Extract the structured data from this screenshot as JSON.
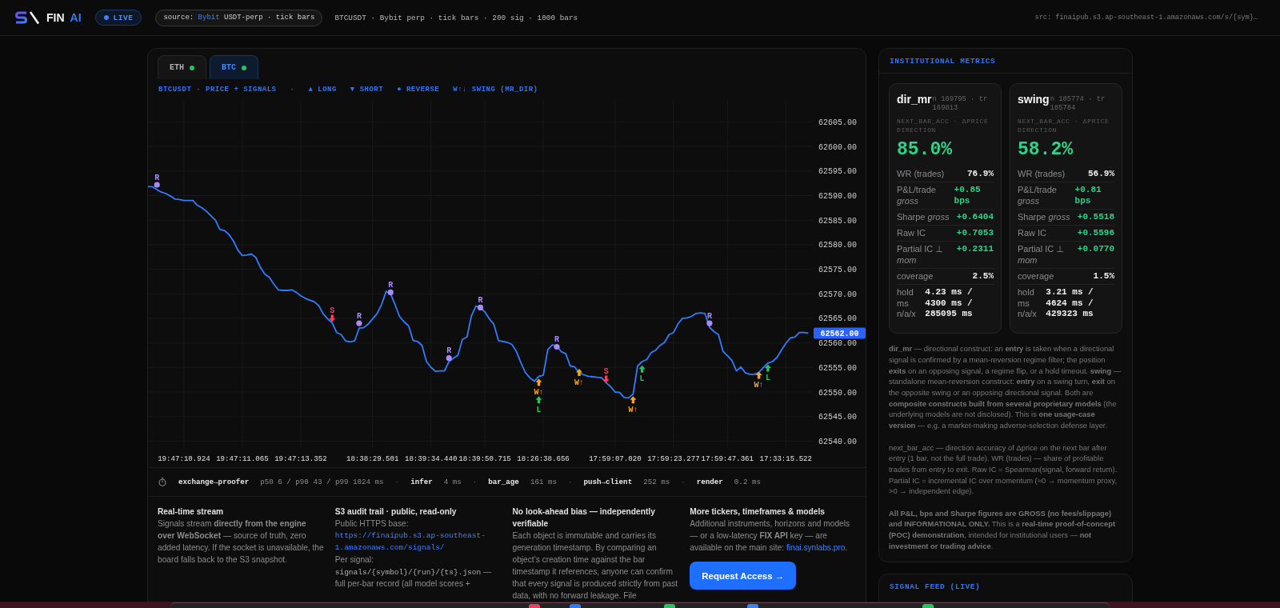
{
  "topbar": {
    "brand": {
      "name": "FIN",
      "accent": "AI"
    },
    "live_badge": "LIVE",
    "source": {
      "prefix": "source:",
      "exchange": "Bybit",
      "suffix": "USDT-perp · tick bars"
    },
    "summary": "BTCUSDT · Bybit perp · tick bars · 200 sig · 1000 bars",
    "src": "src: finaipub.s3.ap-southeast-1.amazonaws.com/s/{sym}…"
  },
  "chart_panel": {
    "tabs": [
      {
        "label": "ETH",
        "selected": false
      },
      {
        "label": "BTC",
        "selected": true
      }
    ],
    "legend_separator": "·",
    "chart_data": {
      "type": "line",
      "title": "BTCUSDT · PRICE + SIGNALS",
      "grid": true,
      "categories": [
        null,
        null,
        null,
        null,
        null,
        null,
        null,
        null,
        "19:47:10.924",
        null,
        null,
        null,
        null,
        null,
        null,
        null,
        null,
        null,
        null,
        null,
        null,
        "19:47:11.065",
        null,
        null,
        null,
        null,
        null,
        null,
        null,
        null,
        null,
        null,
        null,
        null,
        "19:47:13.352",
        null,
        null,
        null,
        null,
        null,
        null,
        null,
        null,
        null,
        null,
        null,
        null,
        null,
        null,
        null,
        "18:38:29.501",
        null,
        null,
        null,
        null,
        null,
        null,
        null,
        null,
        null,
        null,
        null,
        null,
        "18:39:34.440",
        null,
        null,
        null,
        null,
        null,
        null,
        null,
        null,
        null,
        null,
        null,
        "18:39:50.715",
        null,
        null,
        null,
        null,
        null,
        null,
        null,
        null,
        null,
        null,
        null,
        null,
        "18:26:38.656",
        null,
        null,
        null,
        null,
        null,
        null,
        null,
        null,
        null,
        null,
        null,
        null,
        null,
        null,
        null,
        "17:59:07.020",
        null,
        null,
        null,
        null,
        null,
        null,
        null,
        null,
        null,
        null,
        null,
        null,
        "17:59:23.277",
        null,
        null,
        null,
        null,
        null,
        null,
        null,
        null,
        null,
        null,
        null,
        "17:59:47.361",
        null,
        null,
        null,
        null,
        null,
        null,
        null,
        null,
        null,
        null,
        null,
        null,
        "17:33:15.522",
        null,
        null,
        null,
        null,
        null
      ],
      "series": [
        {
          "color": "#2f7dff",
          "values": [
            62591.8,
            62591.8,
            62591.2,
            62590.7,
            62590.4,
            62589.9,
            62589.3,
            62589.2,
            62589.0,
            62589.0,
            62589.0,
            62588.0,
            62587.5,
            62586.8,
            62585.9,
            62585.0,
            62583.1,
            62582.9,
            62582.1,
            62580.8,
            62578.9,
            62577.8,
            62577.9,
            62578.1,
            62577.4,
            62575.4,
            62574.0,
            62573.4,
            62572.0,
            62570.8,
            62570.7,
            62570.7,
            62570.8,
            62570.3,
            62569.6,
            62569.1,
            62568.7,
            62568.4,
            62567.6,
            62565.9,
            62564.9,
            62564.1,
            62562.1,
            62561.7,
            62560.4,
            62560.2,
            62560.4,
            62563.0,
            62563.1,
            62563.8,
            62564.9,
            62566.0,
            62567.8,
            62570.5,
            62570.0,
            62567.8,
            62565.4,
            62564.3,
            62563.5,
            62560.5,
            62560.3,
            62559.5,
            62556.2,
            62555.0,
            62554.2,
            62554.3,
            62554.3,
            62556.2,
            62556.9,
            62557.5,
            62560.7,
            62561.2,
            62565.5,
            62567.5,
            62567.2,
            62566.3,
            62564.9,
            62563.8,
            62560.5,
            62560.3,
            62560.1,
            62559.7,
            62558.3,
            62556.0,
            62554.0,
            62552.9,
            62552.2,
            62553.2,
            62553.4,
            62558.6,
            62559.6,
            62559.4,
            62558.2,
            62557.8,
            62555.3,
            62555.1,
            62553.9,
            62553.5,
            62553.2,
            62553.1,
            62553.0,
            62552.9,
            62551.9,
            62551.1,
            62550.0,
            62549.9,
            62548.9,
            62548.8,
            62549.6,
            62555.3,
            62556.2,
            62556.6,
            62558.0,
            62558.5,
            62559.5,
            62560.1,
            62561.7,
            62562.1,
            62563.9,
            62565.0,
            62565.1,
            62565.4,
            62566.0,
            62566.1,
            62566.0,
            62563.2,
            62562.3,
            62561.7,
            62558.3,
            62557.4,
            62556.4,
            62554.3,
            62555.1,
            62553.9,
            62553.6,
            62553.6,
            62554.0,
            62555.0,
            62555.9,
            62556.2,
            62557.0,
            62558.5,
            62559.9,
            62561.0,
            62561.2,
            62562.1,
            62562.1,
            62562.0
          ]
        },
        {
          "name": "▲ LONG",
          "type": "scatter",
          "color": "#22c55e",
          "values": [
            null,
            null,
            null,
            null,
            null,
            null,
            null,
            null,
            null,
            null,
            null,
            null,
            null,
            null,
            null,
            null,
            null,
            null,
            null,
            null,
            null,
            null,
            null,
            null,
            null,
            null,
            null,
            null,
            null,
            null,
            null,
            null,
            null,
            null,
            null,
            null,
            null,
            null,
            null,
            null,
            null,
            null,
            null,
            null,
            null,
            null,
            null,
            null,
            null,
            null,
            null,
            null,
            null,
            null,
            null,
            null,
            null,
            null,
            null,
            null,
            null,
            null,
            null,
            null,
            null,
            null,
            null,
            null,
            null,
            null,
            null,
            null,
            null,
            null,
            null,
            null,
            null,
            null,
            null,
            null,
            null,
            null,
            null,
            null,
            null,
            null,
            null,
            62548.4,
            null,
            null,
            null,
            null,
            null,
            null,
            null,
            null,
            null,
            null,
            null,
            null,
            null,
            null,
            null,
            null,
            null,
            null,
            null,
            null,
            null,
            null,
            62554.7,
            null,
            null,
            null,
            null,
            null,
            null,
            null,
            null,
            null,
            null,
            null,
            null,
            null,
            null,
            null,
            null,
            null,
            null,
            null,
            null,
            null,
            null,
            null,
            null,
            null,
            null,
            null,
            62554.9,
            null,
            null,
            null,
            null,
            null,
            null,
            null,
            null,
            null
          ]
        },
        {
          "name": "▼ SHORT",
          "type": "scatter",
          "color": "#f2405a",
          "values": [
            null,
            null,
            null,
            null,
            null,
            null,
            null,
            null,
            null,
            null,
            null,
            null,
            null,
            null,
            null,
            null,
            null,
            null,
            null,
            null,
            null,
            null,
            null,
            null,
            null,
            null,
            null,
            null,
            null,
            null,
            null,
            null,
            null,
            null,
            null,
            null,
            null,
            null,
            null,
            null,
            null,
            62565.0,
            null,
            null,
            null,
            null,
            null,
            null,
            null,
            null,
            null,
            null,
            null,
            null,
            null,
            null,
            null,
            null,
            null,
            null,
            null,
            null,
            null,
            null,
            null,
            null,
            null,
            null,
            null,
            null,
            null,
            null,
            null,
            null,
            null,
            null,
            null,
            null,
            null,
            null,
            null,
            null,
            null,
            null,
            null,
            null,
            null,
            null,
            null,
            null,
            null,
            null,
            null,
            null,
            null,
            null,
            null,
            null,
            null,
            null,
            null,
            null,
            62552.6,
            null,
            null,
            null,
            null,
            null,
            null,
            null,
            null,
            null,
            null,
            null,
            null,
            null,
            null,
            null,
            null,
            null,
            null,
            null,
            null,
            null,
            null,
            null,
            null,
            null,
            null,
            null,
            null,
            null,
            null,
            null,
            null,
            null,
            null,
            null,
            null,
            null,
            null,
            null,
            null,
            null,
            null,
            null,
            null,
            null
          ]
        },
        {
          "name": "● REVERSE",
          "type": "scatter",
          "color": "#a78bfa",
          "values": [
            null,
            null,
            62592.2,
            null,
            null,
            null,
            null,
            null,
            null,
            null,
            null,
            null,
            null,
            null,
            null,
            null,
            null,
            null,
            null,
            null,
            null,
            null,
            null,
            null,
            null,
            null,
            null,
            null,
            null,
            null,
            null,
            null,
            null,
            null,
            null,
            null,
            null,
            null,
            null,
            null,
            null,
            null,
            null,
            null,
            null,
            null,
            null,
            62564.0,
            null,
            null,
            null,
            null,
            null,
            null,
            62570.3,
            null,
            null,
            null,
            null,
            null,
            null,
            null,
            null,
            null,
            null,
            null,
            null,
            62556.9,
            null,
            null,
            null,
            null,
            null,
            null,
            62567.2,
            null,
            null,
            null,
            null,
            null,
            null,
            null,
            null,
            null,
            null,
            null,
            null,
            null,
            null,
            null,
            null,
            62559.2,
            null,
            null,
            null,
            null,
            null,
            null,
            null,
            null,
            null,
            null,
            null,
            null,
            null,
            null,
            null,
            null,
            null,
            null,
            null,
            null,
            null,
            null,
            null,
            null,
            null,
            null,
            null,
            null,
            null,
            null,
            null,
            null,
            null,
            62564.0,
            null,
            null,
            null,
            null,
            null,
            null,
            null,
            null,
            null,
            null,
            null,
            null,
            null,
            null,
            null,
            null,
            null,
            null,
            null,
            null,
            null,
            null
          ]
        },
        {
          "name": "W↑↓ SWING (MR_DIR)",
          "type": "scatter",
          "color": "#f5a524",
          "values": [
            null,
            null,
            null,
            null,
            null,
            null,
            null,
            null,
            null,
            null,
            null,
            null,
            null,
            null,
            null,
            null,
            null,
            null,
            null,
            null,
            null,
            null,
            null,
            null,
            null,
            null,
            null,
            null,
            null,
            null,
            null,
            null,
            null,
            null,
            null,
            null,
            null,
            null,
            null,
            null,
            null,
            null,
            null,
            null,
            null,
            null,
            null,
            null,
            null,
            null,
            null,
            null,
            null,
            null,
            null,
            null,
            null,
            null,
            null,
            null,
            null,
            null,
            null,
            null,
            null,
            null,
            null,
            null,
            null,
            null,
            null,
            null,
            null,
            null,
            null,
            null,
            null,
            null,
            null,
            null,
            null,
            null,
            null,
            null,
            null,
            null,
            null,
            62552.0,
            null,
            null,
            null,
            null,
            null,
            null,
            null,
            null,
            62554.0,
            null,
            null,
            null,
            null,
            null,
            null,
            null,
            null,
            null,
            null,
            null,
            62548.4,
            null,
            null,
            null,
            null,
            null,
            null,
            null,
            null,
            null,
            null,
            null,
            null,
            null,
            null,
            null,
            null,
            null,
            null,
            null,
            null,
            null,
            null,
            null,
            null,
            null,
            null,
            null,
            62553.4,
            null,
            null,
            null,
            null,
            null,
            null,
            null,
            null,
            null,
            null,
            null
          ]
        }
      ],
      "ylim": [
        62538.6,
        62609.3
      ],
      "yticks": [
        {
          "value": 62540,
          "label": "62540.00"
        },
        {
          "value": 62545,
          "label": "62545.00"
        },
        {
          "value": 62550,
          "label": "62550.00"
        },
        {
          "value": 62555,
          "label": "62555.00"
        },
        {
          "value": 62560,
          "label": "62560.00"
        },
        {
          "value": 62565,
          "label": "62565.00"
        },
        {
          "value": 62570,
          "label": "62570.00"
        },
        {
          "value": 62575,
          "label": "62575.00"
        },
        {
          "value": 62580,
          "label": "62580.00"
        },
        {
          "value": 62585,
          "label": "62585.00"
        },
        {
          "value": 62590,
          "label": "62590.00"
        },
        {
          "value": 62595,
          "label": "62595.00"
        },
        {
          "value": 62600,
          "label": "62600.00"
        },
        {
          "value": 62605,
          "label": "62605.00"
        }
      ],
      "annotations": [
        "L",
        "L",
        "L",
        "S",
        "S",
        "R",
        "R",
        "R",
        "R",
        "R",
        "R",
        "R",
        "W↑",
        "W↑",
        "W↑",
        "W↑",
        "62562.00"
      ]
    }
  },
  "latency": {
    "separator": "·",
    "items": [
      {
        "name": "exchange→proofer",
        "value": "p50 6 / p90 43 / p99 1024 ms"
      },
      {
        "name": "infer",
        "value": "4 ms"
      },
      {
        "name": "bar_age",
        "value": "161 ms"
      },
      {
        "name": "push→client",
        "value": "252 ms"
      },
      {
        "name": "render",
        "value": "0.2 ms"
      }
    ]
  },
  "info_columns": [
    {
      "kind": "text",
      "title": "Real-time stream",
      "body": "Signals stream **directly from the engine over WebSocket** — source of truth, zero added latency. If the socket is unavailable, the board falls back to the S3 snapshot."
    },
    {
      "kind": "audit",
      "title": "S3 audit trail · public, read-only",
      "body": "Public HTTPS base:",
      "link": "https://finaipub.s3.ap-southeast-1.amazonaws.com/signals/",
      "detail_label": "Per signal:",
      "path": "signals/{symbol}/{run}/{ts}.json",
      "path_note": "— full per-bar record (all model scores +"
    },
    {
      "kind": "text",
      "title": "No look-ahead bias — independently verifiable",
      "body": "Each object is immutable and carries its generation timestamp. By comparing an object’s creation time against the bar timestamp it references, anyone can confirm that every signal is produced strictly from past data, with no forward leakage. File"
    },
    {
      "kind": "cta",
      "title": "More tickers, timeframes & models",
      "body": "Additional instruments, horizons and models — or a low-latency **FIX API** key — are available on the main site:",
      "link": "finai.synlabs.pro",
      "link_suffix": ".",
      "button": "Request Access →"
    }
  ],
  "metrics": {
    "title": "INSTITUTIONAL METRICS",
    "models": [
      {
        "name": "dir_mr",
        "meta": "n 169795 · tr 169813",
        "caption": "NEXT_BAR_ACC · ΔPRICE DIRECTION",
        "headline": "85.0%",
        "rows": [
          {
            "label": "WR (trades)",
            "value": "76.9%",
            "color": "#f0f0f0"
          },
          {
            "label": "P&L/trade *gross*",
            "value": "+0.85 bps",
            "color": "#2ad48a"
          },
          {
            "label": "Sharpe *gross*",
            "value": "+0.6404",
            "color": "#2ad48a"
          },
          {
            "label": "Raw IC",
            "value": "+0.7053",
            "color": "#2ad48a"
          },
          {
            "label": "Partial IC ⊥ *mom*",
            "value": "+0.2311",
            "color": "#2ad48a"
          },
          {
            "label": "coverage",
            "value": "2.5%",
            "color": "#f0f0f0"
          },
          {
            "label": "hold ms n/a/x",
            "value": "4.23 ms / 4300 ms / 285095 ms",
            "color": "#f0f0f0"
          }
        ]
      },
      {
        "name": "swing",
        "meta": "n 185774 · tr 185784",
        "caption": "NEXT_BAR_ACC · ΔPRICE DIRECTION",
        "headline": "58.2%",
        "rows": [
          {
            "label": "WR (trades)",
            "value": "56.9%",
            "color": "#f0f0f0"
          },
          {
            "label": "P&L/trade *gross*",
            "value": "+0.81 bps",
            "color": "#2ad48a"
          },
          {
            "label": "Sharpe *gross*",
            "value": "+0.5518",
            "color": "#2ad48a"
          },
          {
            "label": "Raw IC",
            "value": "+0.5596",
            "color": "#2ad48a"
          },
          {
            "label": "Partial IC ⊥ *mom*",
            "value": "+0.0770",
            "color": "#2ad48a"
          },
          {
            "label": "coverage",
            "value": "1.5%",
            "color": "#f0f0f0"
          },
          {
            "label": "hold ms n/a/x",
            "value": "3.21 ms / 4624 ms / 429323 ms",
            "color": "#f0f0f0"
          }
        ]
      }
    ],
    "notes": [
      "**dir_mr** — directional construct: an **entry** is taken when a directional signal is confirmed by a mean-reversion regime filter; the position **exits** on an opposing signal, a regime flip, or a hold timeout. **swing** — standalone mean-reversion construct: **entry** on a swing turn, **exit** on the opposite swing or an opposing directional signal. Both are **composite constructs built from several proprietary models** (the underlying models are not disclosed). This is **one usage-case version** — e.g. a market-making adverse-selection defense layer.",
      "next_bar_acc — direction accuracy of Δprice on the next bar after entry (1 bar, not the full trade). WR (trades) — share of profitable trades from entry to exit. Raw IC = Spearman(signal, forward return). Partial IC = incremental IC over momentum (≈0 → momentum proxy, >0 → independent edge).",
      "**All P&L, bps and Sharpe figures are GROSS (no fees/slippage) and INFORMATIONAL ONLY.** This is a **real-time proof-of-concept (POC) demonstration**, intended for institutional users — **not investment or trading advice**."
    ]
  },
  "signal_feed": {
    "title": "SIGNAL FEED (LIVE)"
  }
}
